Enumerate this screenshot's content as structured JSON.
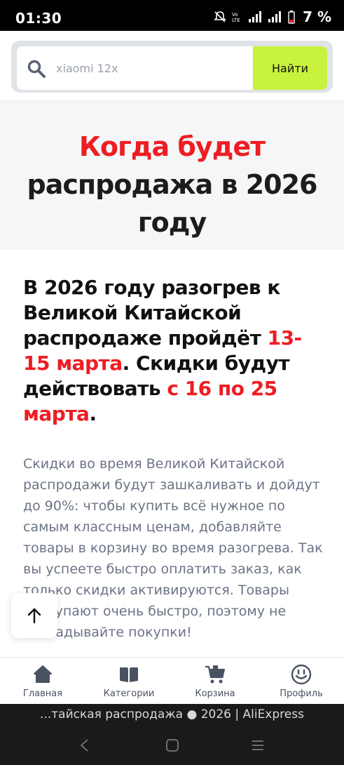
{
  "status_bar": {
    "time": "01:30",
    "battery_percent": "7 %"
  },
  "search": {
    "placeholder": "xiaomi 12x",
    "button_label": "Найти"
  },
  "hero": {
    "title_red": "Когда будет",
    "title_line2": "распродажа в 2026",
    "title_line3": "году"
  },
  "lead": {
    "part1": "В 2026 году разогрев к Великой Китайской распродаже пройдёт ",
    "highlight1": "13-15 марта",
    "part2": ". Скидки будут действовать ",
    "highlight2": "с 16 по 25 марта",
    "part3": "."
  },
  "body_text": "Скидки во время Великой Китайской распродажи будут зашкаливать и дойдут до 90%: чтобы купить всё нужное по самым классным ценам, добавляйте товары в корзину во время разогрева. Так вы успеете быстро оплатить заказ, как только скидки активируются. Товары раскупают очень быстро, поэтому не откладывайте покупки!",
  "bottom_nav": [
    {
      "label": "Главная",
      "icon": "home-icon"
    },
    {
      "label": "Категории",
      "icon": "book-icon"
    },
    {
      "label": "Корзина",
      "icon": "cart-icon"
    },
    {
      "label": "Профиль",
      "icon": "smile-icon"
    }
  ],
  "browser_title": "...тайская распродажа ● 2026 | AliExpress",
  "colors": {
    "accent_red": "#ee1d23",
    "search_button": "#c8f23c"
  }
}
